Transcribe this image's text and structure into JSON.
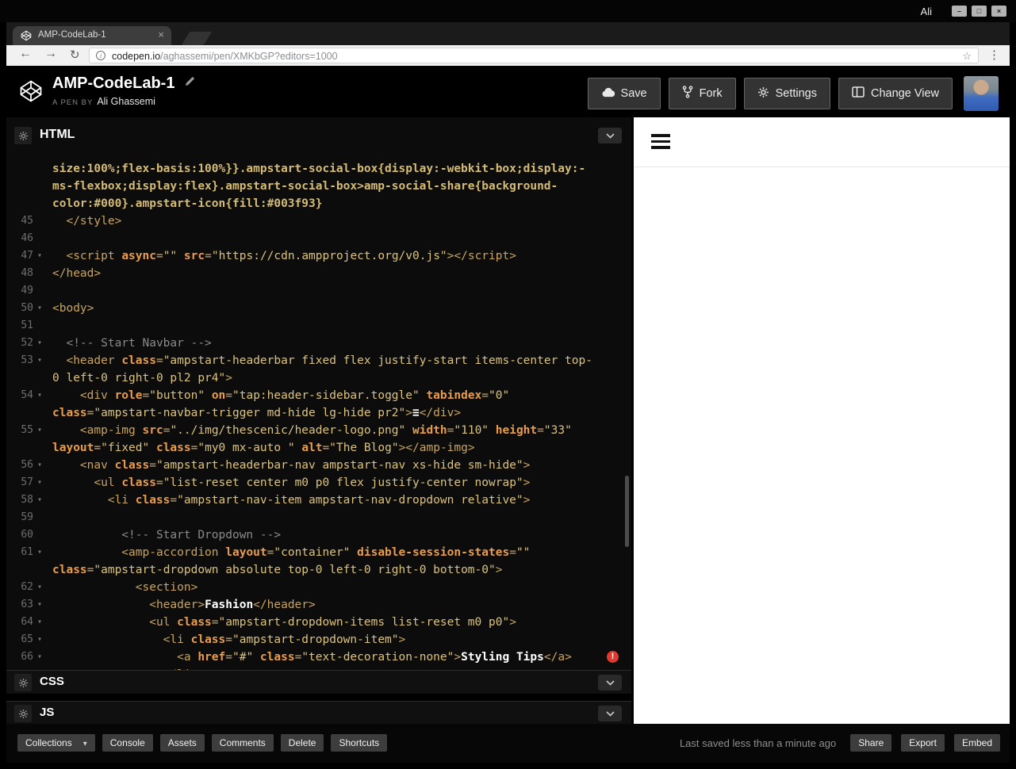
{
  "colors": {
    "tok_tag": "#c9a45f",
    "tok_attr": "#e89d4c",
    "tok_str": "#dcc37c",
    "tok_com": "#8a8a8a",
    "tok_txt": "#ffffff",
    "tok_css": "#d5bc74",
    "gutter": "#6e6e6e",
    "error": "#df3a2d",
    "editor_bg": "#0c0c0c",
    "panel_header_bg": "#101010",
    "footer_btn_bg": "#3d3d3d",
    "preview_bg": "#ffffff",
    "toolbar_bg": "#f1f1f1",
    "accent_border": "#666666"
  },
  "icons": {
    "back": "←",
    "forward": "→",
    "reload": "↻",
    "star": "☆",
    "kebab": "⋮",
    "info": "i",
    "caret": "▾",
    "tab_close": "×",
    "min": "–",
    "max": "□",
    "close": "×"
  },
  "browser": {
    "user": "Ali",
    "tab_title": "AMP-CodeLab-1",
    "url_domain": "codepen.io",
    "url_path": "/aghassemi/pen/XMKbGP?editors=1000"
  },
  "pen": {
    "title": "AMP-CodeLab-1",
    "byline_prefix": "A PEN BY",
    "author": "Ali Ghassemi",
    "actions": {
      "save": "Save",
      "fork": "Fork",
      "settings": "Settings",
      "change_view": "Change View"
    }
  },
  "editor": {
    "sections": {
      "html": "HTML",
      "css": "CSS",
      "js": "JS"
    },
    "lines": [
      {
        "s": [
          [
            "css",
            "size:100%;flex-basis:100%}}.ampstart-social-box{display:-webkit-box;display:-"
          ]
        ]
      },
      {
        "s": [
          [
            "css",
            "ms-flexbox;display:flex}.ampstart-social-box>amp-social-share{background-"
          ]
        ]
      },
      {
        "s": [
          [
            "css",
            "color:#000}.ampstart-icon{fill:#003f93}"
          ]
        ]
      },
      {
        "n": "45",
        "s": [
          [
            "tag",
            "  </style>"
          ]
        ]
      },
      {
        "n": "46",
        "s": []
      },
      {
        "n": "47",
        "f": 1,
        "s": [
          [
            "tag",
            "  <script "
          ],
          [
            "attr",
            "async"
          ],
          [
            "tag",
            "="
          ],
          [
            "str",
            "\"\""
          ],
          [
            "tag",
            " "
          ],
          [
            "attr",
            "src"
          ],
          [
            "tag",
            "="
          ],
          [
            "str",
            "\"https://cdn.ampproject.org/v0.js\""
          ],
          [
            "tag",
            "></script>"
          ]
        ]
      },
      {
        "n": "48",
        "s": [
          [
            "tag",
            "</head>"
          ]
        ]
      },
      {
        "n": "49",
        "s": []
      },
      {
        "n": "50",
        "f": 1,
        "s": [
          [
            "tag",
            "<body>"
          ]
        ]
      },
      {
        "n": "51",
        "s": []
      },
      {
        "n": "52",
        "f": 1,
        "s": [
          [
            "com",
            "  <!-- Start Navbar -->"
          ]
        ]
      },
      {
        "n": "53",
        "f": 1,
        "s": [
          [
            "tag",
            "  <header "
          ],
          [
            "attr",
            "class"
          ],
          [
            "tag",
            "="
          ],
          [
            "str",
            "\"ampstart-headerbar fixed flex justify-start items-center top-"
          ]
        ]
      },
      {
        "s": [
          [
            "str",
            "0 left-0 right-0 pl2 pr4\""
          ],
          [
            "tag",
            ">"
          ]
        ]
      },
      {
        "n": "54",
        "f": 1,
        "s": [
          [
            "tag",
            "    <div "
          ],
          [
            "attr",
            "role"
          ],
          [
            "tag",
            "="
          ],
          [
            "str",
            "\"button\""
          ],
          [
            "tag",
            " "
          ],
          [
            "attr",
            "on"
          ],
          [
            "tag",
            "="
          ],
          [
            "str",
            "\"tap:header-sidebar.toggle\""
          ],
          [
            "tag",
            " "
          ],
          [
            "attr",
            "tabindex"
          ],
          [
            "tag",
            "="
          ],
          [
            "str",
            "\"0\""
          ]
        ]
      },
      {
        "s": [
          [
            "attr",
            "class"
          ],
          [
            "tag",
            "="
          ],
          [
            "str",
            "\"ampstart-navbar-trigger md-hide lg-hide pr2\""
          ],
          [
            "tag",
            ">"
          ],
          [
            "txt",
            "≡"
          ],
          [
            "tag",
            "</div>"
          ]
        ]
      },
      {
        "n": "55",
        "f": 1,
        "s": [
          [
            "tag",
            "    <amp-img "
          ],
          [
            "attr",
            "src"
          ],
          [
            "tag",
            "="
          ],
          [
            "str",
            "\"../img/thescenic/header-logo.png\""
          ],
          [
            "tag",
            " "
          ],
          [
            "attr",
            "width"
          ],
          [
            "tag",
            "="
          ],
          [
            "str",
            "\"110\""
          ],
          [
            "tag",
            " "
          ],
          [
            "attr",
            "height"
          ],
          [
            "tag",
            "="
          ],
          [
            "str",
            "\"33\""
          ]
        ]
      },
      {
        "s": [
          [
            "attr",
            "layout"
          ],
          [
            "tag",
            "="
          ],
          [
            "str",
            "\"fixed\""
          ],
          [
            "tag",
            " "
          ],
          [
            "attr",
            "class"
          ],
          [
            "tag",
            "="
          ],
          [
            "str",
            "\"my0 mx-auto \""
          ],
          [
            "tag",
            " "
          ],
          [
            "attr",
            "alt"
          ],
          [
            "tag",
            "="
          ],
          [
            "str",
            "\"The Blog\""
          ],
          [
            "tag",
            "></amp-img>"
          ]
        ]
      },
      {
        "n": "56",
        "f": 1,
        "s": [
          [
            "tag",
            "    <nav "
          ],
          [
            "attr",
            "class"
          ],
          [
            "tag",
            "="
          ],
          [
            "str",
            "\"ampstart-headerbar-nav ampstart-nav xs-hide sm-hide\""
          ],
          [
            "tag",
            ">"
          ]
        ]
      },
      {
        "n": "57",
        "f": 1,
        "s": [
          [
            "tag",
            "      <ul "
          ],
          [
            "attr",
            "class"
          ],
          [
            "tag",
            "="
          ],
          [
            "str",
            "\"list-reset center m0 p0 flex justify-center nowrap\""
          ],
          [
            "tag",
            ">"
          ]
        ]
      },
      {
        "n": "58",
        "f": 1,
        "s": [
          [
            "tag",
            "        <li "
          ],
          [
            "attr",
            "class"
          ],
          [
            "tag",
            "="
          ],
          [
            "str",
            "\"ampstart-nav-item ampstart-nav-dropdown relative\""
          ],
          [
            "tag",
            ">"
          ]
        ]
      },
      {
        "n": "59",
        "s": []
      },
      {
        "n": "60",
        "s": [
          [
            "com",
            "          <!-- Start Dropdown -->"
          ]
        ]
      },
      {
        "n": "61",
        "f": 1,
        "s": [
          [
            "tag",
            "          <amp-accordion "
          ],
          [
            "attr",
            "layout"
          ],
          [
            "tag",
            "="
          ],
          [
            "str",
            "\"container\""
          ],
          [
            "tag",
            " "
          ],
          [
            "attr",
            "disable-session-states"
          ],
          [
            "tag",
            "="
          ],
          [
            "str",
            "\"\""
          ]
        ]
      },
      {
        "s": [
          [
            "attr",
            "class"
          ],
          [
            "tag",
            "="
          ],
          [
            "str",
            "\"ampstart-dropdown absolute top-0 left-0 right-0 bottom-0\""
          ],
          [
            "tag",
            ">"
          ]
        ]
      },
      {
        "n": "62",
        "f": 1,
        "s": [
          [
            "tag",
            "            <section>"
          ]
        ]
      },
      {
        "n": "63",
        "f": 1,
        "s": [
          [
            "tag",
            "              <header>"
          ],
          [
            "txt",
            "Fashion"
          ],
          [
            "tag",
            "</header>"
          ]
        ]
      },
      {
        "n": "64",
        "f": 1,
        "s": [
          [
            "tag",
            "              <ul "
          ],
          [
            "attr",
            "class"
          ],
          [
            "tag",
            "="
          ],
          [
            "str",
            "\"ampstart-dropdown-items list-reset m0 p0\""
          ],
          [
            "tag",
            ">"
          ]
        ]
      },
      {
        "n": "65",
        "f": 1,
        "s": [
          [
            "tag",
            "                <li "
          ],
          [
            "attr",
            "class"
          ],
          [
            "tag",
            "="
          ],
          [
            "str",
            "\"ampstart-dropdown-item\""
          ],
          [
            "tag",
            ">"
          ]
        ]
      },
      {
        "n": "66",
        "f": 1,
        "err": 1,
        "s": [
          [
            "tag",
            "                  <a "
          ],
          [
            "attr",
            "href"
          ],
          [
            "tag",
            "="
          ],
          [
            "str",
            "\"#\""
          ],
          [
            "tag",
            " "
          ],
          [
            "attr",
            "class"
          ],
          [
            "tag",
            "="
          ],
          [
            "str",
            "\"text-decoration-none\""
          ],
          [
            "tag",
            ">"
          ],
          [
            "txt",
            "Styling Tips"
          ],
          [
            "tag",
            "</a>"
          ]
        ]
      },
      {
        "s": [
          [
            "tag",
            "                </li"
          ]
        ]
      }
    ]
  },
  "footer": {
    "collections": "Collections",
    "buttons": [
      "Console",
      "Assets",
      "Comments",
      "Delete",
      "Shortcuts"
    ],
    "status": "Last saved less than a minute ago",
    "actions": [
      "Share",
      "Export",
      "Embed"
    ]
  }
}
